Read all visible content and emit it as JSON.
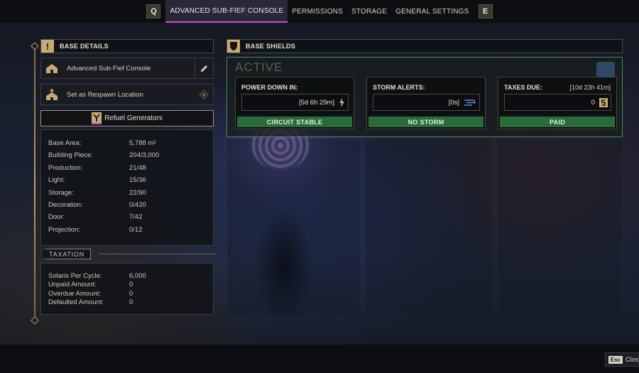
{
  "nav": {
    "left_key": "Q",
    "right_key": "E",
    "tabs": [
      {
        "label": "ADVANCED SUB-FIEF CONSOLE",
        "active": true
      },
      {
        "label": "PERMISSIONS",
        "active": false
      },
      {
        "label": "STORAGE",
        "active": false
      },
      {
        "label": "GENERAL SETTINGS",
        "active": false
      }
    ],
    "accent_color": "#c24fd6"
  },
  "base_details": {
    "heading": "BASE DETAILS",
    "heading_icon": "!",
    "console_name": "Advanced Sub-Fief Console",
    "respawn_label": "Set as Respawn Location",
    "refuel_label": "Refuel Generators",
    "stats": [
      {
        "label": "Base Area:",
        "value": "5,788 m²"
      },
      {
        "label": "Building Piece:",
        "value": "204/3,000"
      },
      {
        "label": "Production:",
        "value": "21/48"
      },
      {
        "label": "Light:",
        "value": "15/36"
      },
      {
        "label": "Storage:",
        "value": "22/90"
      },
      {
        "label": "Decoration:",
        "value": "0/420"
      },
      {
        "label": "Door:",
        "value": "7/42"
      },
      {
        "label": "Projection:",
        "value": "0/12"
      }
    ]
  },
  "taxation": {
    "heading": "TAXATION",
    "rows": [
      {
        "label": "Solaris Per Cycle:",
        "value": "6,000"
      },
      {
        "label": "Unpaid Amount:",
        "value": "0"
      },
      {
        "label": "Overdue Amount:",
        "value": "0"
      },
      {
        "label": "Defaulted Amount:",
        "value": "0"
      }
    ]
  },
  "base_shields": {
    "heading": "BASE SHIELDS",
    "state": "ACTIVE",
    "status_color": "#2a6b3a",
    "cards": [
      {
        "title": "POWER DOWN IN:",
        "extra": "",
        "value": "[5d 6h 29m]",
        "icon": "lightning-icon",
        "status": "CIRCUIT STABLE"
      },
      {
        "title": "STORM ALERTS:",
        "extra": "",
        "value": "[0s]",
        "icon": "storm-icon",
        "status": "NO STORM"
      },
      {
        "title": "TAXES DUE:",
        "extra": "[10d 23h 41m]",
        "value": "0",
        "icon": "solari-icon",
        "status": "PAID"
      }
    ]
  },
  "footer": {
    "esc_key": "Esc",
    "close_label": "Close"
  }
}
